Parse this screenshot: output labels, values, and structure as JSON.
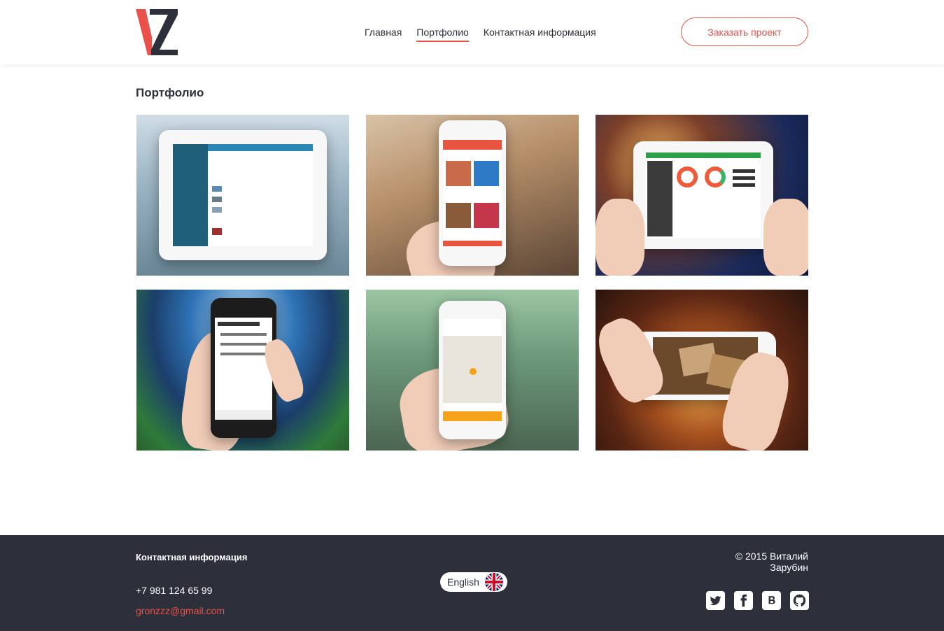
{
  "brand": {
    "logo_text": "VZ",
    "accent_color": "#e9524a",
    "dark_color": "#2d303b"
  },
  "nav": {
    "items": [
      {
        "label": "Главная",
        "active": false
      },
      {
        "label": "Портфолио",
        "active": true
      },
      {
        "label": "Контактная информация",
        "active": false
      }
    ],
    "order_button": "Заказать проект"
  },
  "portfolio": {
    "title": "Портфолио",
    "items": [
      {
        "icon": "tablet-app-screenshot"
      },
      {
        "icon": "phone-app-screenshot"
      },
      {
        "icon": "tablet-dashboard-screenshot"
      },
      {
        "icon": "phone-upcoming-games-screenshot"
      },
      {
        "icon": "phone-map-screenshot"
      },
      {
        "icon": "phone-game-screenshot"
      }
    ]
  },
  "footer": {
    "contact_title": "Контактная информация",
    "phone": "+7 981 124 65 99",
    "email": "gronzzz@gmail.com",
    "language": "English",
    "copyright": "© 2015 Виталий Зарубин",
    "socials": [
      "twitter-icon",
      "facebook-icon",
      "vk-icon",
      "github-icon"
    ]
  }
}
